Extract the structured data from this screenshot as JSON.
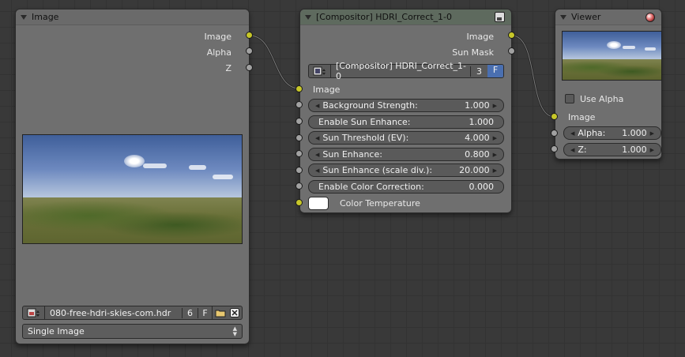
{
  "nodes": {
    "image": {
      "title": "Image",
      "outputs": [
        "Image",
        "Alpha",
        "Z"
      ],
      "filename": "080-free-hdri-skies-com.hdr",
      "users": "6",
      "fake_user": "F",
      "source": "Single Image"
    },
    "group": {
      "title": "[Compositor] HDRI_Correct_1-0",
      "outputs": [
        "Image",
        "Sun Mask"
      ],
      "datablock_name": "[Compositor] HDRI_Correct_1-0",
      "users": "3",
      "fake_user": "F",
      "inputs": {
        "image": "Image",
        "color_temperature": "Color Temperature"
      },
      "sliders": [
        {
          "label": "Background Strength:",
          "value": "1.000"
        },
        {
          "label": "Enable Sun Enhance:",
          "value": "1.000"
        },
        {
          "label": "Sun Threshold (EV):",
          "value": "4.000"
        },
        {
          "label": "Sun Enhance:",
          "value": "0.800"
        },
        {
          "label": "Sun Enhance (scale div.):",
          "value": "20.000"
        },
        {
          "label": "Enable Color Correction:",
          "value": "0.000"
        }
      ]
    },
    "viewer": {
      "title": "Viewer",
      "use_alpha_label": "Use Alpha",
      "input_image": "Image",
      "alpha": {
        "label": "Alpha:",
        "value": "1.000"
      },
      "z": {
        "label": "Z:",
        "value": "1.000"
      }
    }
  },
  "colors": {
    "socket_color": "#c7c729",
    "socket_value": "#a1a1a1",
    "node_body": "#6f6f6f",
    "grid_bg": "#393939",
    "users_button": "#4a6fb0"
  },
  "icons": [
    "node-collapse-arrow-icon",
    "viewer-record-icon",
    "group-node-icon",
    "image-browse-icon",
    "open-folder-icon",
    "unlink-x-icon",
    "select-arrows-icon",
    "slider-left-arrow-icon",
    "slider-right-arrow-icon"
  ]
}
